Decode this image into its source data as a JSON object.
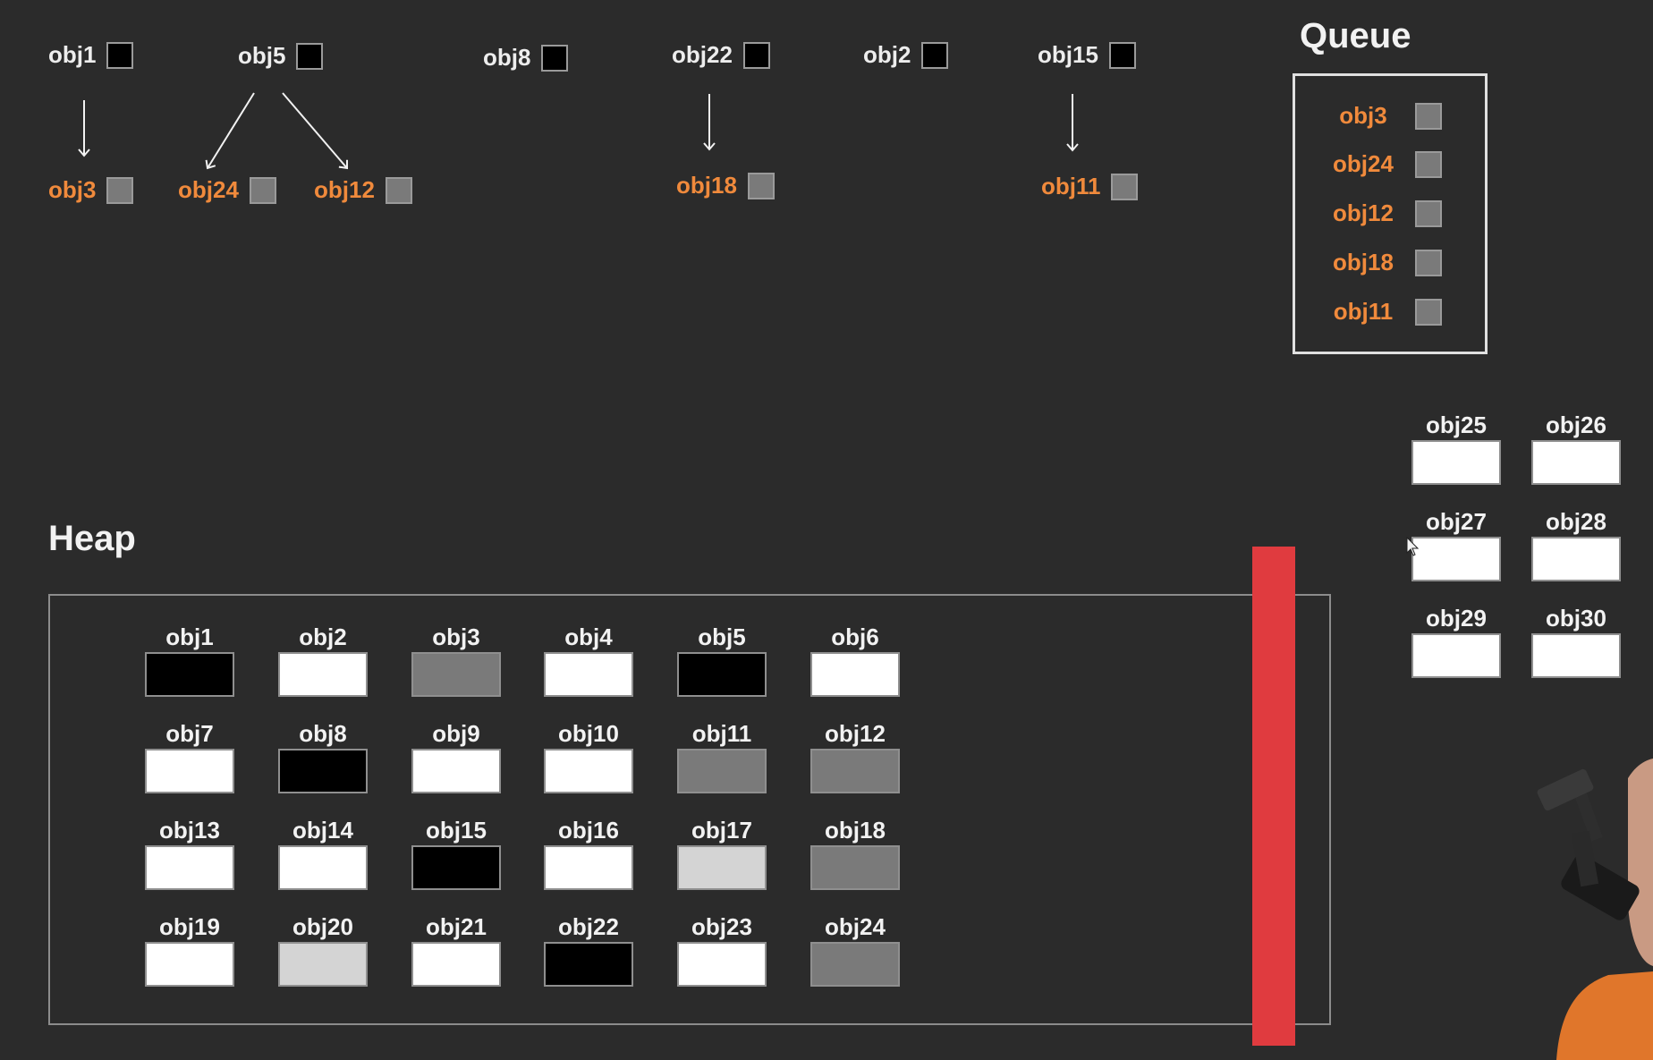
{
  "roots": [
    {
      "label": "obj1",
      "color": "black"
    },
    {
      "label": "obj5",
      "color": "black"
    },
    {
      "label": "obj8",
      "color": "black"
    },
    {
      "label": "obj22",
      "color": "black"
    },
    {
      "label": "obj2",
      "color": "black"
    },
    {
      "label": "obj15",
      "color": "black"
    }
  ],
  "children": [
    {
      "label": "obj3",
      "color": "gray"
    },
    {
      "label": "obj24",
      "color": "gray"
    },
    {
      "label": "obj12",
      "color": "gray"
    },
    {
      "label": "obj18",
      "color": "gray"
    },
    {
      "label": "obj11",
      "color": "gray"
    }
  ],
  "queue": {
    "title": "Queue",
    "items": [
      "obj3",
      "obj24",
      "obj12",
      "obj18",
      "obj11"
    ]
  },
  "free_objects": [
    {
      "label": "obj25",
      "color": "white"
    },
    {
      "label": "obj26",
      "color": "white"
    },
    {
      "label": "obj27",
      "color": "white"
    },
    {
      "label": "obj28",
      "color": "white"
    },
    {
      "label": "obj29",
      "color": "white"
    },
    {
      "label": "obj30",
      "color": "white"
    }
  ],
  "heap": {
    "title": "Heap",
    "cells": [
      {
        "label": "obj1",
        "color": "black"
      },
      {
        "label": "obj2",
        "color": "white"
      },
      {
        "label": "obj3",
        "color": "gray"
      },
      {
        "label": "obj4",
        "color": "white"
      },
      {
        "label": "obj5",
        "color": "black"
      },
      {
        "label": "obj6",
        "color": "white"
      },
      {
        "label": "obj7",
        "color": "white"
      },
      {
        "label": "obj8",
        "color": "black"
      },
      {
        "label": "obj9",
        "color": "white"
      },
      {
        "label": "obj10",
        "color": "white"
      },
      {
        "label": "obj11",
        "color": "gray"
      },
      {
        "label": "obj12",
        "color": "gray"
      },
      {
        "label": "obj13",
        "color": "white"
      },
      {
        "label": "obj14",
        "color": "white"
      },
      {
        "label": "obj15",
        "color": "black"
      },
      {
        "label": "obj16",
        "color": "white"
      },
      {
        "label": "obj17",
        "color": "light"
      },
      {
        "label": "obj18",
        "color": "gray"
      },
      {
        "label": "obj19",
        "color": "white"
      },
      {
        "label": "obj20",
        "color": "light"
      },
      {
        "label": "obj21",
        "color": "white"
      },
      {
        "label": "obj22",
        "color": "black"
      },
      {
        "label": "obj23",
        "color": "white"
      },
      {
        "label": "obj24",
        "color": "gray"
      }
    ]
  },
  "references": [
    {
      "from": "obj1",
      "to": "obj3"
    },
    {
      "from": "obj5",
      "to": "obj24"
    },
    {
      "from": "obj5",
      "to": "obj12"
    },
    {
      "from": "obj22",
      "to": "obj18"
    },
    {
      "from": "obj15",
      "to": "obj11"
    }
  ],
  "colors": {
    "background": "#2b2b2b",
    "child_label": "#f08a3c",
    "black": "#000000",
    "gray": "#7a7a7a",
    "light": "#d4d4d4",
    "white": "#ffffff",
    "sweep_bar": "#e03b3f"
  }
}
